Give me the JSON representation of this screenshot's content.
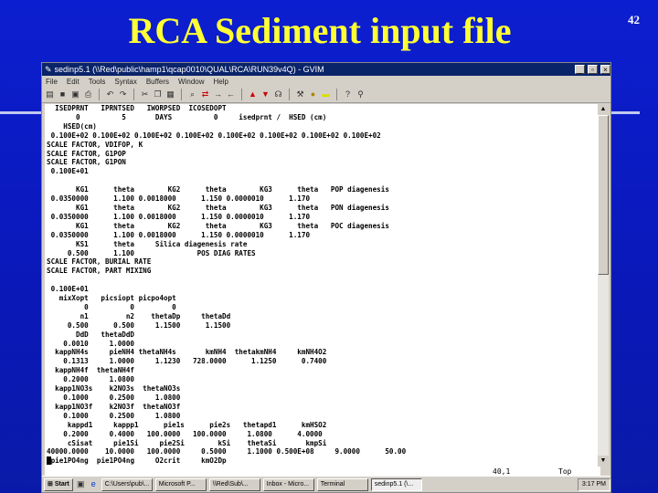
{
  "slide": {
    "title": "RCA Sediment input file",
    "page_number": "42"
  },
  "window": {
    "title": "sedinp5.1 (\\\\Red\\public\\hamp1\\qcap0010\\QUAL\\RCA\\RUN39v4Q) - GVIM"
  },
  "menu": [
    "File",
    "Edit",
    "Tools",
    "Syntax",
    "Buffers",
    "Window",
    "Help"
  ],
  "toolbar": [
    "open-icon",
    "save-icon",
    "save-all-icon",
    "print-icon",
    "undo-icon",
    "redo-icon",
    "cut-icon",
    "copy-icon",
    "paste-icon",
    "find-icon",
    "replace-icon",
    "find-next-icon",
    "find-prev-icon",
    "load-session-icon",
    "save-session-icon",
    "run-script-icon",
    "make-icon",
    "shell-icon",
    "tags-icon",
    "help-icon",
    "find-help-icon"
  ],
  "editor_lines": [
    "  ISEDPRNT   IPRNTSED   IWORPSED  ICOSEDOPT",
    "       0          5       DAYS          0     isedprnt /  HSED (cm)",
    "    HSED(cm)",
    " 0.100E+02 0.100E+02 0.100E+02 0.100E+02 0.100E+02 0.100E+02 0.100E+02 0.100E+02",
    "SCALE FACTOR, VDIFOP, K",
    "SCALE FACTOR, G1POP",
    "SCALE FACTOR, G1PON",
    " 0.100E+01",
    "",
    "       KG1      theta        KG2      theta        KG3      theta   POP diagenesis",
    " 0.0350000      1.100 0.0018000      1.150 0.0000010      1.170",
    "       KG1      theta        KG2      theta        KG3      theta   PON diagenesis",
    " 0.0350000      1.100 0.0018000      1.150 0.0000010      1.170",
    "       KG1      theta        KG2      theta        KG3      theta   POC diagenesis",
    " 0.0350000      1.100 0.0018000      1.150 0.0000010      1.170",
    "       KS1      theta     Silica diagenesis rate",
    "     0.500      1.100               POS DIAG RATES",
    "SCALE FACTOR, BURIAL RATE",
    "SCALE FACTOR, PART MIXING",
    "",
    " 0.100E+01",
    "   mixXopt   picsiopt picpo4opt",
    "         0          0         0",
    "        n1         n2    thetaDp     thetaDd",
    "     0.500      0.500     1.1500      1.1500",
    "       DdD   thetaDdD",
    "    0.0010     1.0000",
    "  kappNH4s     pieNH4 thetaNH4s       kmNH4  thetakmNH4     kmNH4O2",
    "    0.1313     1.0000     1.1230   728.0000      1.1250      0.7400",
    "  kappNH4f  thetaNH4f",
    "    0.2000     1.0800",
    "  kapp1NO3s    k2NO3s  thetaNO3s",
    "    0.1000     0.2500     1.0800",
    "  kapp1NO3f    k2NO3f  thetaNO3f",
    "    0.1000     0.2500     1.0800",
    "     kappd1     kappp1      pie1s      pie2s   thetapd1      kmHSO2",
    "    0.2000     0.4000   100.0000   100.0000     1.0800      4.0000",
    "     cSisat     pie1Si     pie2Si        kSi    thetaSi       kmpSi",
    "40000.0000    10.0000   100.0000     0.5000     1.1000 0.500E+08     9.0000      50.00",
    " pie1PO4ng  pie1PO4ng     O2crit     kmO2Dp"
  ],
  "status": {
    "position": "40,1",
    "scroll": "Top"
  },
  "taskbar": {
    "start": "Start",
    "buttons": [
      "C:\\Users\\pub\\...",
      "Microsoft P...",
      "\\\\Red\\Sub\\...",
      "Inbox - Micro...",
      "Terminal",
      "sedinp5.1 (\\..."
    ],
    "clock": "3:17 PM"
  }
}
